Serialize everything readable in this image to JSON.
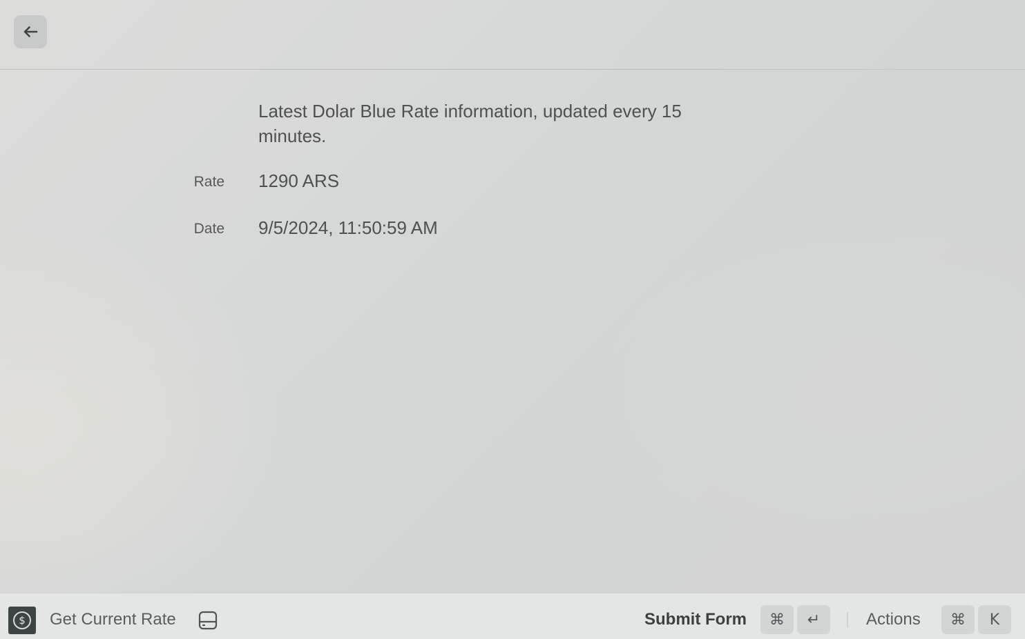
{
  "header": {
    "back_icon": "arrow-left-icon"
  },
  "detail": {
    "description": "Latest Dolar Blue Rate information, updated every 15 minutes.",
    "fields": [
      {
        "label": "Rate",
        "value": "1290 ARS"
      },
      {
        "label": "Date",
        "value": "9/5/2024, 11:50:59 AM"
      }
    ]
  },
  "footer": {
    "app_icon": "dollar-coin-icon",
    "app_icon_glyph": "$",
    "command_title": "Get Current Rate",
    "form_icon": "form-icon",
    "primary_action": {
      "label": "Submit Form",
      "shortcut": [
        "⌘",
        "↵"
      ]
    },
    "actions": {
      "label": "Actions",
      "shortcut": [
        "⌘",
        "K"
      ]
    }
  },
  "colors": {
    "text_primary": "#4e5052",
    "footer_bg": "#e4e5e5",
    "key_bg": "#d3d4d4"
  }
}
